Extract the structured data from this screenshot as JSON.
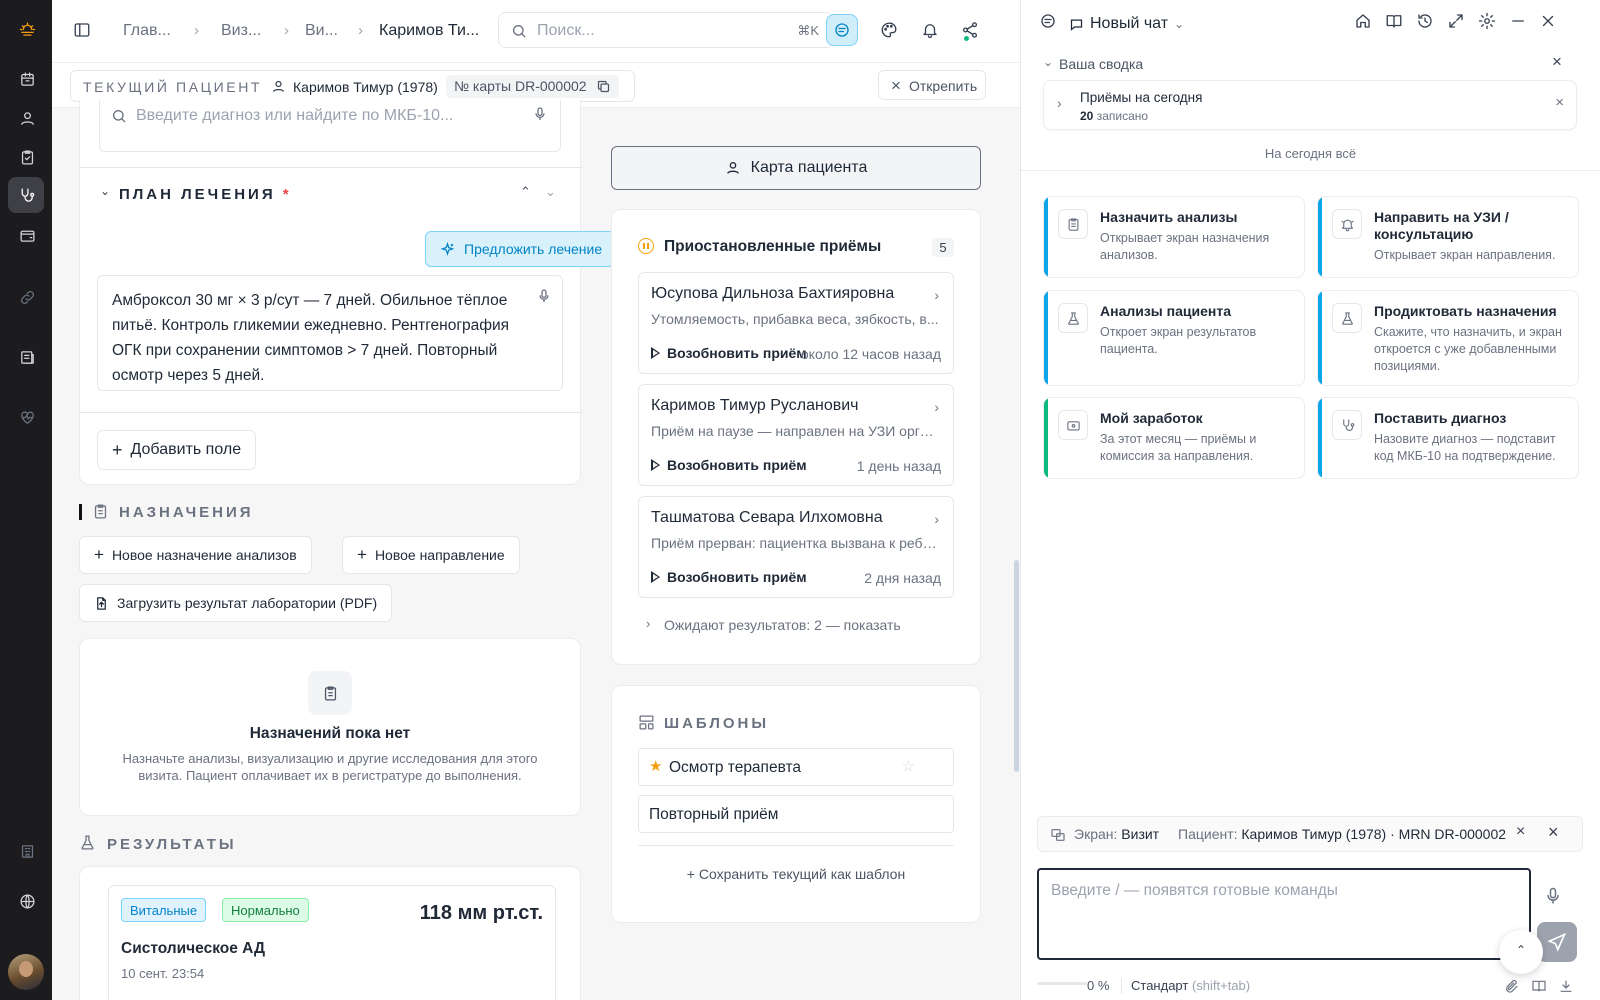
{
  "header": {
    "breadcrumbs": [
      "Глав...",
      "Виз...",
      "Ви...",
      "Каримов Ти..."
    ],
    "search_placeholder": "Поиск...",
    "search_shortcut": "⌘K"
  },
  "patient_bar": {
    "label": "ТЕКУЩИЙ ПАЦИЕНТ",
    "patient": "Каримов Тимур (1978)",
    "card": "№ карты DR-000002",
    "unpin": "Открепить"
  },
  "diagnosis": {
    "placeholder": "Введите диагноз или найдите по МКБ-10..."
  },
  "plan": {
    "title": "ПЛАН ЛЕЧЕНИЯ",
    "required_mark": "*",
    "suggest_button": "Предложить лечение",
    "text": "Амброксол 30 мг × 3 р/сут — 7 дней. Обильное тёплое питьё. Контроль гликемии ежедневно. Рентгенография ОГК при сохранении симптомов > 7 дней. Повторный осмотр через 5 дней.",
    "add_field": "Добавить поле"
  },
  "orders": {
    "title": "НАЗНАЧЕНИЯ",
    "new_lab": "Новое назначение анализов",
    "new_referral": "Новое направление",
    "upload": "Загрузить результат лаборатории (PDF)",
    "empty_title": "Назначений пока нет",
    "empty_text": "Назначьте анализы, визуализацию и другие исследования для этого визита. Пациент оплачивает их в регистратуре до выполнения."
  },
  "results": {
    "title": "РЕЗУЛЬТАТЫ",
    "item": {
      "tag1": "Витальные",
      "tag2": "Нормально",
      "value": "118 мм рт.ст.",
      "name": "Систолическое АД",
      "date": "10 сент. 23:54"
    }
  },
  "right_column": {
    "patient_card_button": "Карта пациента",
    "suspended": {
      "title": "Приостановленные приёмы",
      "count": "5",
      "items": [
        {
          "name": "Юсупова Дильноза Бахтияровна",
          "desc": "Утомляемость, прибавка веса, зябкость, в...",
          "resume": "Возобновить приём",
          "time": "около 12 часов назад"
        },
        {
          "name": "Каримов Тимур Русланович",
          "desc": "Приём на паузе — направлен на УЗИ орган...",
          "resume": "Возобновить приём",
          "time": "1 день назад"
        },
        {
          "name": "Ташматова Севара Илхомовна",
          "desc": "Приём прерван: пациентка вызвана к ребё...",
          "resume": "Возобновить приём",
          "time": "2 дня назад"
        }
      ],
      "awaiting": "Ожидают результатов: 2 — показать"
    },
    "templates": {
      "title": "ШАБЛОНЫ",
      "items": [
        "Осмотр терапевта",
        "Повторный приём"
      ],
      "save": "Сохранить текущий как шаблон"
    }
  },
  "chat": {
    "title": "Новый чат",
    "summary_label": "Ваша сводка",
    "today_title": "Приёмы на сегодня",
    "today_count": "20",
    "today_suffix": "записано",
    "all_done": "На сегодня всё",
    "tiles": [
      {
        "title": "Назначить анализы",
        "desc": "Открывает экран назначения анализов.",
        "icon": "clipboard-icon",
        "accent": "#0ea5e9"
      },
      {
        "title": "Направить на УЗИ / консультацию",
        "desc": "Открывает экран направления.",
        "icon": "bell-ring-icon",
        "accent": "#0ea5e9"
      },
      {
        "title": "Анализы пациента",
        "desc": "Откроет экран результатов пациента.",
        "icon": "flask-icon",
        "accent": "#0ea5e9"
      },
      {
        "title": "Продиктовать назначения",
        "desc": "Скажите, что назначить, и экран откроется с уже добавленными позициями.",
        "icon": "flask-icon",
        "accent": "#0ea5e9"
      },
      {
        "title": "Мой заработок",
        "desc": "За этот месяц — приёмы и комиссия за направления.",
        "icon": "wallet-icon",
        "accent": "#10b981"
      },
      {
        "title": "Поставить диагноз",
        "desc": "Назовите диагноз — подставит код МКБ-10 на подтверждение.",
        "icon": "stethoscope-icon",
        "accent": "#0ea5e9"
      }
    ],
    "context": {
      "screen_label": "Экран:",
      "screen_value": "Визит",
      "patient_label": "Пациент:",
      "patient_value": "Каримов Тимур (1978) · MRN DR-000002"
    },
    "input_placeholder": "Введите / — появятся готовые команды",
    "footer": {
      "percent": "0 %",
      "mode": "Стандарт",
      "mode_hint": "(shift+tab)"
    }
  }
}
